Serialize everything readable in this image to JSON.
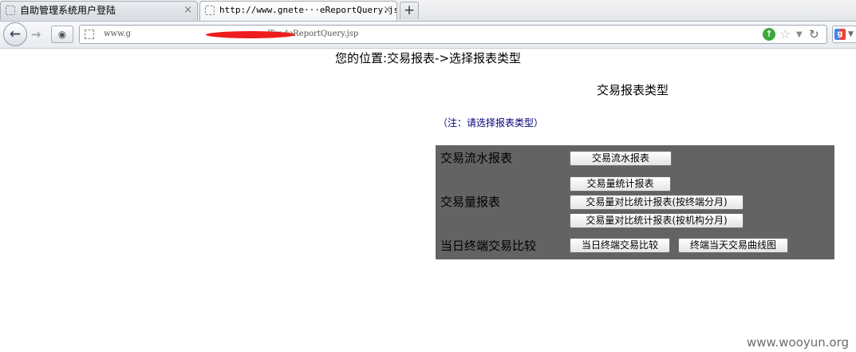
{
  "browser": {
    "tabs": [
      {
        "title": "自助管理系统用户登陆",
        "close": "×"
      },
      {
        "title": "http://www.gnete···eReportQuery.jsp",
        "close": "×"
      }
    ],
    "new_tab_label": "+",
    "address": {
      "prefix": "www.g",
      "suffix": "/TradeReportQuery.jsp"
    },
    "icons": {
      "back": "back-arrow-icon",
      "forward": "forward-arrow-icon",
      "identity": "identity-icon",
      "go": "go-icon",
      "star": "bookmark-star-icon",
      "dropdown": "history-dropdown-icon",
      "reload": "reload-icon",
      "search_engine": "google-icon"
    }
  },
  "page": {
    "location": "您的位置:交易报表->选择报表类型",
    "section_title": "交易报表类型",
    "note": "（注：请选择报表类型）",
    "panel_color": "#626464",
    "rows": [
      {
        "label": "交易流水报表",
        "buttons": [
          "交易流水报表"
        ]
      },
      {
        "label": "交易量报表",
        "buttons": [
          "交易量统计报表",
          "交易量对比统计报表(按终端分月)",
          "交易量对比统计报表(按机构分月)"
        ]
      },
      {
        "label": "当日终端交易比较",
        "buttons": [
          "当日终端交易比较",
          "终端当天交易曲线图"
        ]
      }
    ]
  },
  "watermark": "www.wooyun.org"
}
